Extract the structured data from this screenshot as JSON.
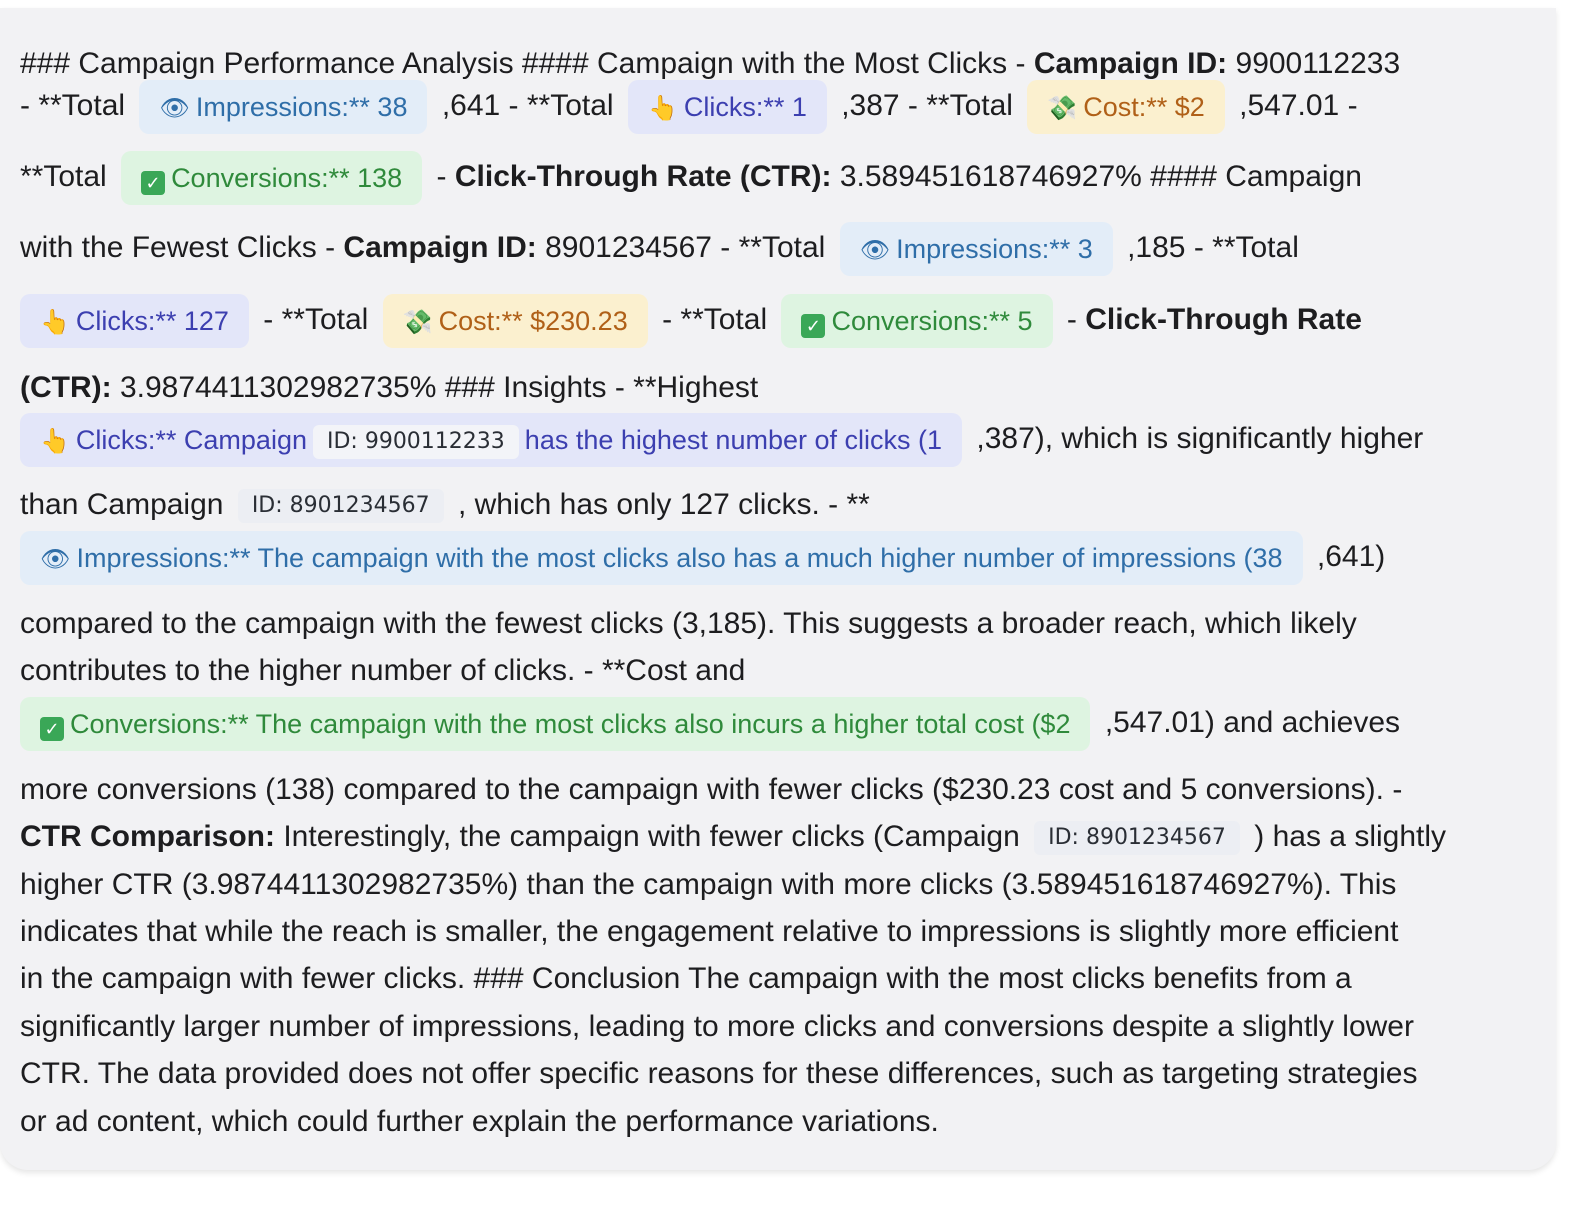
{
  "l1": {
    "a": "### Campaign Performance Analysis #### Campaign with the Most Clicks - ",
    "b": "Campaign ID:",
    "c": " 9900112233"
  },
  "l2": {
    "a": "- **Total",
    "imp_icon": "👁",
    "imp_text": "Impressions:** 38",
    "b": ",641 - **Total",
    "clk_icon": "👆",
    "clk_text": "Clicks:** 1",
    "c": ",387 - **Total",
    "cost_icon": "💸",
    "cost_text": "Cost:** $2",
    "d": ",547.01 -"
  },
  "l3": {
    "a": "**Total",
    "conv_icon": "✓",
    "conv_text": "Conversions:** 138",
    "b": "- ",
    "c": "Click-Through Rate (CTR):",
    "d": " 3.589451618746927% #### Campaign"
  },
  "l4": {
    "a": "with the Fewest Clicks - ",
    "b": "Campaign ID:",
    "c": " 8901234567 - **Total",
    "imp_icon": "👁",
    "imp_text": "Impressions:** 3",
    "d": ",185 - **Total"
  },
  "l5": {
    "clk_icon": "👆",
    "clk_text": "Clicks:** 127",
    "a": "- **Total",
    "cost_icon": "💸",
    "cost_text": "Cost:** $230.23",
    "b": "- **Total",
    "conv_icon": "✓",
    "conv_text": "Conversions:** 5",
    "c": "- ",
    "d": "Click-Through Rate"
  },
  "l6": {
    "a": "(CTR):",
    "b": " 3.9874411302982735% ### Insights - **Highest"
  },
  "l7": {
    "clk_icon": "👆",
    "clk_a": "Clicks:** Campaign",
    "code": "ID: 9900112233",
    "clk_b": "has the highest number of clicks (1",
    "b": ",387), which is significantly higher"
  },
  "l8": {
    "a": "than Campaign",
    "code": "ID: 8901234567",
    "b": ", which has only 127 clicks. - **"
  },
  "l9": {
    "imp_icon": "👁",
    "imp_text": "Impressions:** The campaign with the most clicks also has a much higher number of impressions (38",
    "b": ",641)"
  },
  "l10": "compared to the campaign with the fewest clicks (3,185). This suggests a broader reach, which likely",
  "l11": "contributes to the higher number of clicks. - **Cost and",
  "l12": {
    "conv_icon": "✓",
    "conv_text": "Conversions:** The campaign with the most clicks also incurs a higher total cost ($2",
    "b": ",547.01) and achieves"
  },
  "l13": "more conversions (138) compared to the campaign with fewer clicks ($230.23 cost and 5 conversions). -",
  "l14": {
    "a": "CTR Comparison:",
    "b": " Interestingly, the campaign with fewer clicks (Campaign",
    "code": "ID: 8901234567",
    "c": ") has a slightly"
  },
  "l15": "higher CTR (3.9874411302982735%) than the campaign with more clicks (3.589451618746927%). This",
  "l16": "indicates that while the reach is smaller, the engagement relative to impressions is slightly more efficient",
  "l17": "in the campaign with fewer clicks. ### Conclusion The campaign with the most clicks benefits from a",
  "l18": "significantly larger number of impressions, leading to more clicks and conversions despite a slightly lower",
  "l19": "CTR. The data provided does not offer specific reasons for these differences, such as targeting strategies",
  "l20": "or ad content, which could further explain the performance variations."
}
